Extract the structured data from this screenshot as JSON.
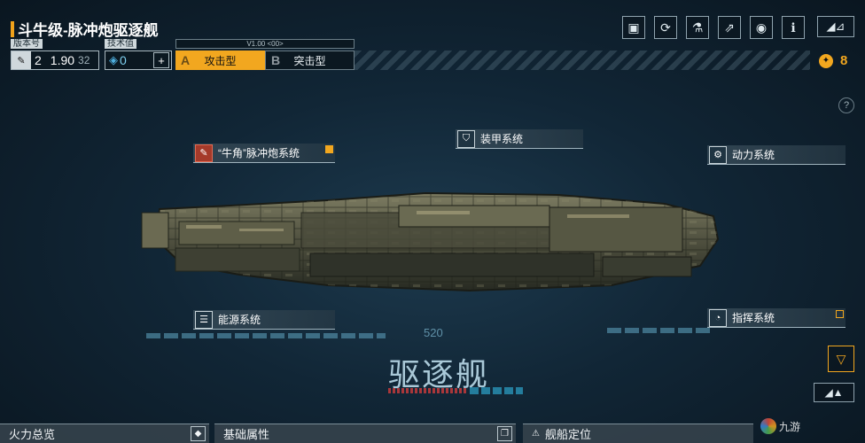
{
  "header": {
    "title": "斗牛级-脉冲炮驱逐舰",
    "back_label": "◢⊿"
  },
  "version": {
    "label": "版本号",
    "level": "2",
    "value_main": "1.90",
    "value_sub": "32"
  },
  "tech": {
    "label": "技术值",
    "value": "0",
    "add_label": "+"
  },
  "mode": {
    "version_text": "V1.00 <00>",
    "tabs": [
      {
        "letter": "A",
        "label": "攻击型",
        "active": true
      },
      {
        "letter": "B",
        "label": "突击型",
        "active": false
      }
    ]
  },
  "currency": {
    "value": "8"
  },
  "help_label": "?",
  "callouts": {
    "cannon": "“牛角”脉冲炮系统",
    "armor": "装甲系统",
    "power": "动力系统",
    "energy": "能源系统",
    "command": "指挥系统"
  },
  "ship": {
    "class_name": "驱逐舰",
    "number": "520"
  },
  "bottom_tabs": [
    {
      "label": "火力总览"
    },
    {
      "label": "基础属性"
    },
    {
      "label": "舰船定位"
    }
  ],
  "watermark": "九游",
  "colors": {
    "accent": "#f2a71f",
    "background": "#112636",
    "panel": "#0b1821"
  }
}
